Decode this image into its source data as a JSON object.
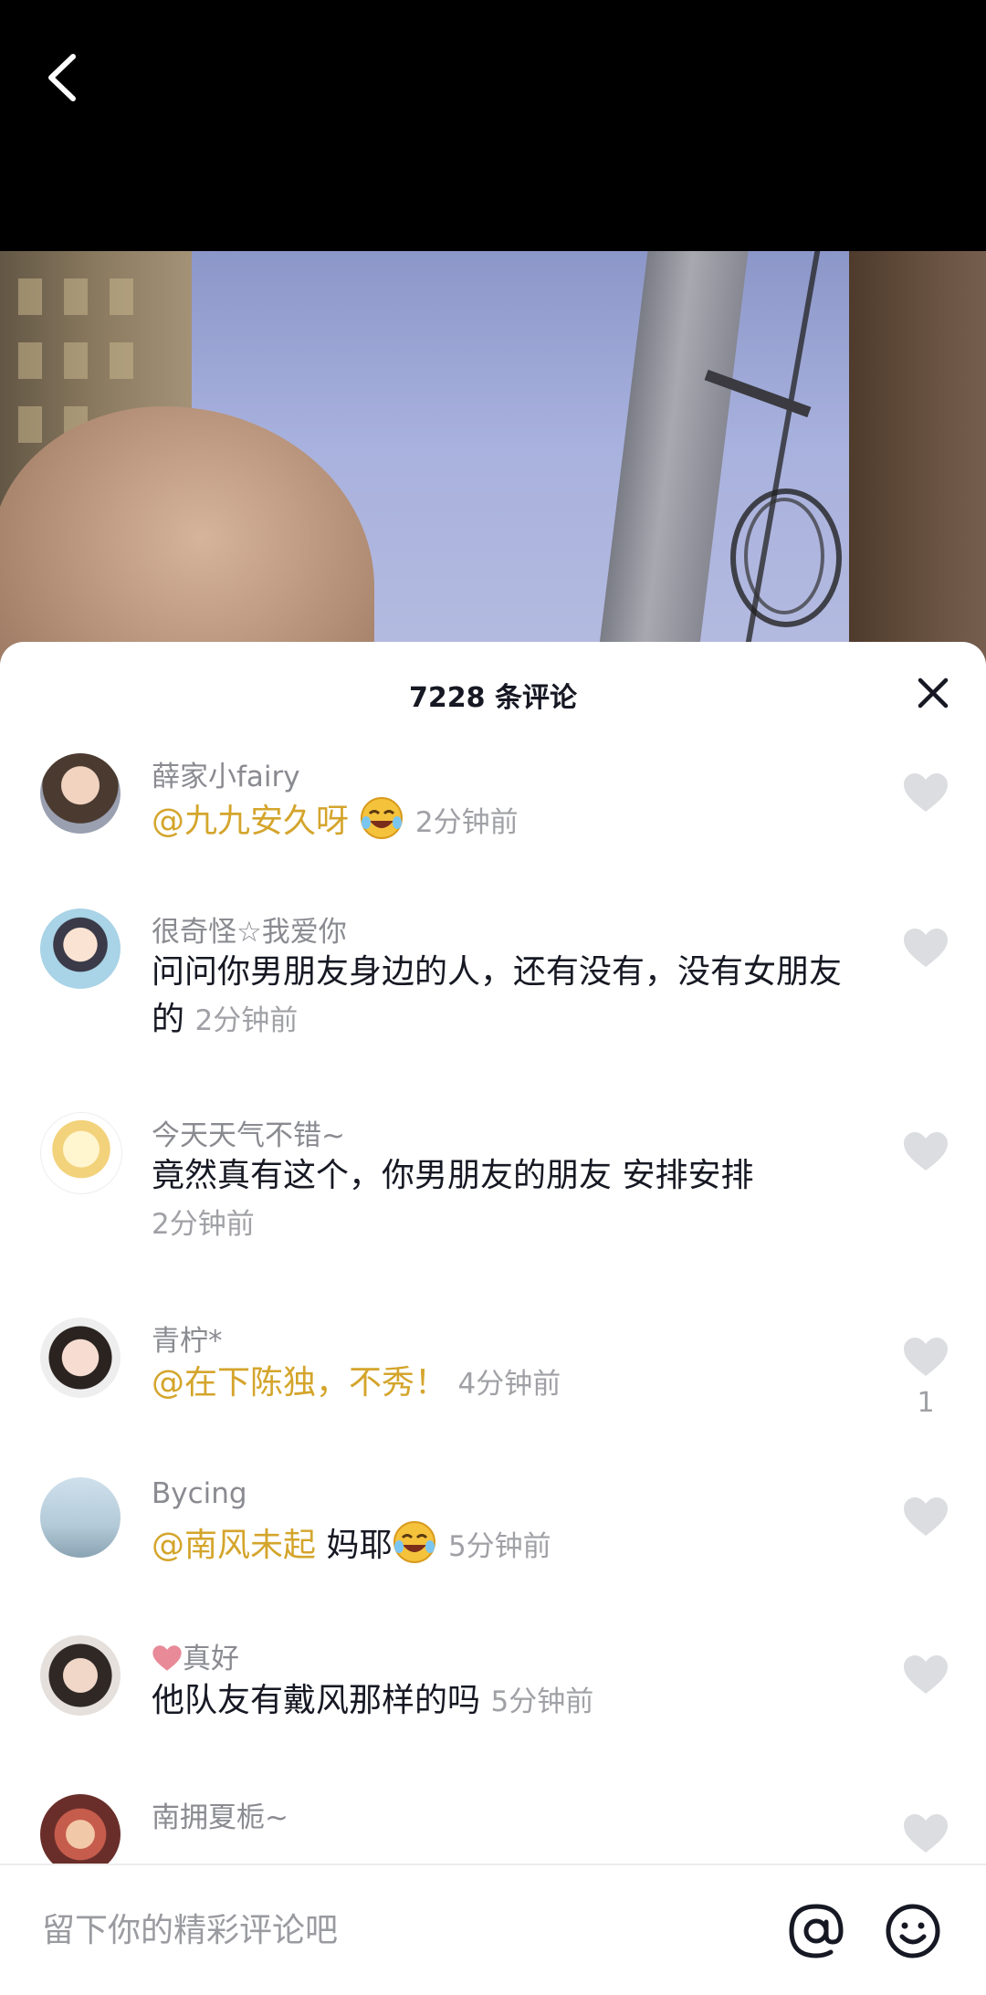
{
  "header": {
    "back_icon": "chevron-left-icon"
  },
  "sheet": {
    "title": "7228 条评论",
    "close_icon": "close-icon"
  },
  "comments": [
    {
      "name": "薛家小fairy",
      "mention": "@九九安久呀",
      "text": "",
      "emoji": "laughing-tears-emoji",
      "time": "2分钟前",
      "likes": ""
    },
    {
      "name": "很奇怪☆我爱你",
      "mention": "",
      "text": "问问你男朋友身边的人，还有没有，没有女朋友的",
      "emoji": "",
      "time": "2分钟前",
      "likes": ""
    },
    {
      "name": "今天天气不错~",
      "mention": "",
      "text": "竟然真有这个，你男朋友的朋友 安排安排",
      "emoji": "",
      "time": "2分钟前",
      "likes": ""
    },
    {
      "name": "青柠*",
      "mention": "@在下陈独，不秀！",
      "text": "",
      "emoji": "",
      "time": "4分钟前",
      "likes": "1"
    },
    {
      "name": "Bycing",
      "mention": "@南风未起",
      "text": "妈耶",
      "emoji": "laughing-tears-emoji",
      "time": "5分钟前",
      "likes": ""
    },
    {
      "name": "真好",
      "name_prefix_icon": "heart-icon",
      "mention": "",
      "text": "他队友有戴风那样的吗",
      "emoji": "",
      "time": "5分钟前",
      "likes": ""
    },
    {
      "name": "南拥夏栀~",
      "mention": "",
      "text": "",
      "emoji": "",
      "time": "",
      "likes": ""
    }
  ],
  "input": {
    "placeholder": "留下你的精彩评论吧"
  },
  "icons": {
    "at": "at-icon",
    "emoji": "smiley-icon",
    "like": "heart-outline-icon"
  },
  "colors": {
    "mention": "#d4a52c",
    "time": "#a0a1a6",
    "name": "#8a8b91",
    "text": "#161823",
    "like": "#dcdde0"
  }
}
